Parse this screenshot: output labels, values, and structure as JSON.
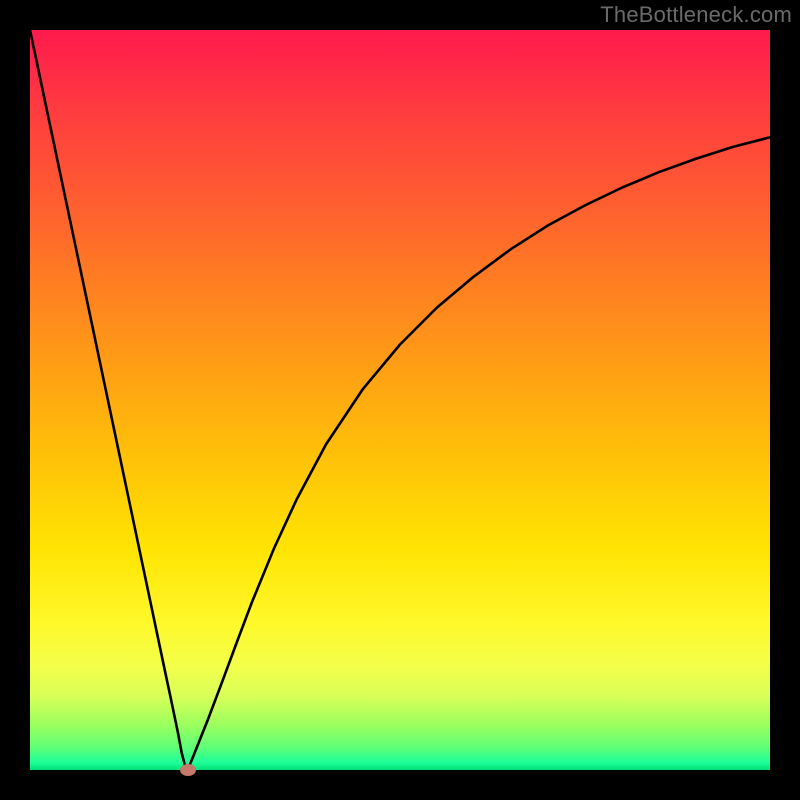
{
  "attribution": "TheBottleneck.com",
  "colors": {
    "frame": "#000000",
    "dot": "#c47a6a",
    "curve": "#000000"
  },
  "chart_data": {
    "type": "line",
    "title": "",
    "xlabel": "",
    "ylabel": "",
    "xlim": [
      0,
      100
    ],
    "ylim": [
      0,
      100
    ],
    "grid": false,
    "series": [
      {
        "name": "bottleneck-curve",
        "x": [
          0,
          2,
          4,
          6,
          8,
          10,
          12,
          14,
          16,
          18,
          19,
          20,
          20.5,
          21,
          21.3,
          22,
          23,
          24,
          26,
          28,
          30,
          33,
          36,
          40,
          45,
          50,
          55,
          60,
          65,
          70,
          75,
          80,
          85,
          90,
          95,
          100
        ],
        "y": [
          100,
          90.5,
          81,
          71.5,
          62,
          52.5,
          43,
          33.5,
          24,
          14.5,
          9.8,
          5.0,
          2.3,
          0.4,
          0.0,
          1.7,
          4.2,
          6.7,
          12.0,
          17.4,
          22.7,
          30.0,
          36.5,
          44.0,
          51.5,
          57.5,
          62.5,
          66.7,
          70.4,
          73.6,
          76.3,
          78.7,
          80.8,
          82.6,
          84.2,
          85.5
        ]
      }
    ],
    "minimum_point": {
      "x": 21.3,
      "y": 0.0
    }
  }
}
